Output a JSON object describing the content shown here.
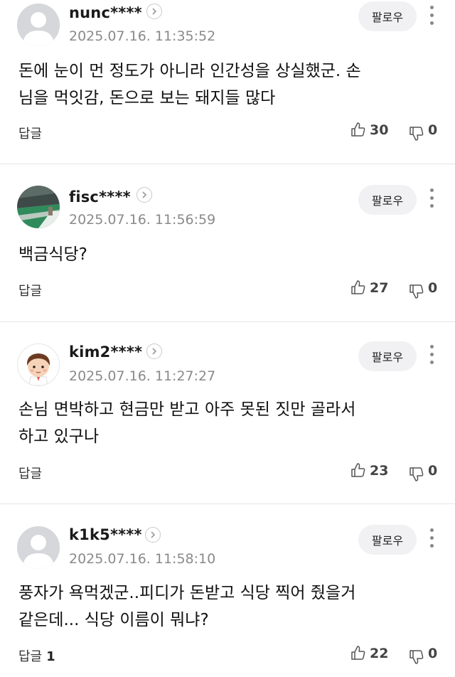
{
  "comments": [
    {
      "username": "nunc****",
      "timestamp": "2025.07.16. 11:35:52",
      "follow_label": "팔로우",
      "lines": [
        "돈에 눈이 먼 정도가 아니라 인간성을 상실했군. 손",
        "님을 먹잇감, 돈으로 보는 돼지들 많다"
      ],
      "reply_label": "답글",
      "reply_count": "",
      "likes": "30",
      "dislikes": "0",
      "avatar": "default-avatar"
    },
    {
      "username": "fisc****",
      "timestamp": "2025.07.16. 11:56:59",
      "follow_label": "팔로우",
      "lines": [
        "백금식당?"
      ],
      "reply_label": "답글",
      "reply_count": "",
      "likes": "27",
      "dislikes": "0",
      "avatar": "photo-avatar"
    },
    {
      "username": "kim2****",
      "timestamp": "2025.07.16. 11:27:27",
      "follow_label": "팔로우",
      "lines": [
        "손님 면박하고 현금만 받고 아주 못된 짓만 골라서",
        "하고 있구나"
      ],
      "reply_label": "답글",
      "reply_count": "",
      "likes": "23",
      "dislikes": "0",
      "avatar": "cartoon-avatar"
    },
    {
      "username": "k1k5****",
      "timestamp": "2025.07.16. 11:58:10",
      "follow_label": "팔로우",
      "lines": [
        "풍자가 욕먹겠군..피디가 돈받고 식당 찍어 줬을거",
        "같은데... 식당 이름이 뭐냐?"
      ],
      "reply_label": "답글",
      "reply_count": "1",
      "likes": "22",
      "dislikes": "0",
      "avatar": "default-avatar"
    }
  ]
}
